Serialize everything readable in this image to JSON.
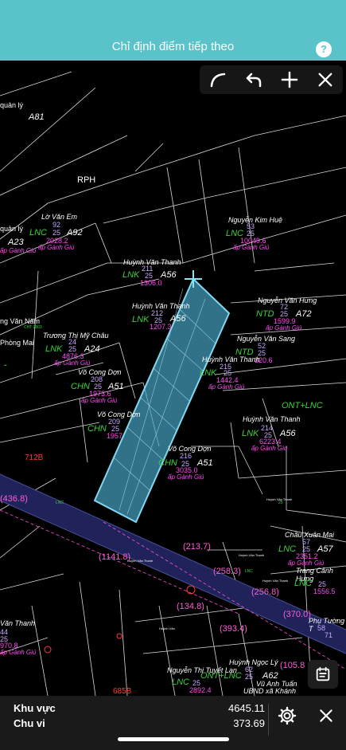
{
  "header": {
    "title": "Chỉ định điểm tiếp theo",
    "help_label": "?"
  },
  "toolbar": {
    "icons": [
      "curve-tool-icon",
      "undo-icon",
      "add-point-icon",
      "close-icon"
    ]
  },
  "colors": {
    "header_bg": "#5ac3c9",
    "map_bg": "#000000",
    "parcel_fill": "#5ab4d2",
    "land_code": "#3ad13a",
    "parcel_number": "#c8a6ff",
    "area": "#ff4df2",
    "road": "#2a2f6e",
    "dimension": "#ff5cd8"
  },
  "map": {
    "labels": {
      "quan_ly_top": "quản lý",
      "a81": "A81",
      "rph": "RPH",
      "lo_van_em": "Lờ Văn Em",
      "lnc_1": "LNC",
      "num_92": "92",
      "num_25a": "25",
      "a92": "A92",
      "area_2028": "2028.2",
      "ap_1": "ấp Gành Giú",
      "quan_ly_2": "quản lý",
      "a23": "A23",
      "ap_2": "ấp Gành Giú",
      "nguyen_kim_hue": "Nguyễn Kim Huệ",
      "num_53": "53",
      "lnc_2": "LNC",
      "num_25b": "25",
      "area_10049": "10049.6",
      "ap_3": "ấp Gành Giú",
      "huynh_van_thanh_1": "Huỳnh Văn Thanh",
      "lnk_1": "LNK",
      "num_211": "211",
      "num_25c": "25",
      "a56_1": "A56",
      "area_1306": "1306.0",
      "huynh_van_thanh_2": "Huỳnh Văn Thanh",
      "lnk_2": "LNK",
      "num_212": "212",
      "num_25d": "25",
      "a56_2": "A56",
      "area_1207": "1207.3",
      "nguyen_van_hung": "Nguyễn Văn Hưng",
      "ntd_1": "NTD",
      "num_72": "72",
      "num_25e": "25",
      "a72": "A72",
      "area_1599": "1599.9",
      "ap_4": "ấp Gành Giú",
      "ng_van_nam": "ng Văn Năm",
      "phong_mai": "Phòng Mai",
      "truong_thi_my_chau": "Trương Thị Mỹ Châu",
      "lnk_3": "LNK",
      "num_24": "24",
      "num_25f": "25",
      "a24": "A24",
      "area_4876": "4876.3",
      "ap_5": "ấp Gành Giú",
      "nguyen_van_sang": "Nguyễn Văn Sang",
      "ntd_2": "NTD",
      "num_52": "52",
      "num_25g": "25",
      "area_320": "320.6",
      "vo_cong_don_1": "Võ Cong Dợn",
      "chn_1": "CHN",
      "num_208": "208",
      "num_25h": "25",
      "a51_1": "A51",
      "area_1973": "1973.6",
      "ap_6": "ấp Gành Giú",
      "huynh_van_thanh_3": "Huỳnh Văn Thanh",
      "lnk_4": "LNK",
      "num_215": "215",
      "num_25i": "25",
      "area_1442": "1442.4",
      "ap_7": "ấp Gành Giú",
      "ont_lnc_1": "ONT+LNC",
      "vo_cong_don_2": "Võ Cong Dợn",
      "chn_2": "CHN",
      "num_209": "209",
      "num_25j": "25",
      "area_1957": "1957",
      "huynh_van_thanh_4": "Huỳnh Văn Thanh",
      "lnk_5": "LNK",
      "num_214": "214",
      "num_25k": "25",
      "a56_3": "A56",
      "area_6223": "6223.4",
      "ap_8": "ấp Gành Giú",
      "vo_cong_don_3": "Võ Cong Dợn",
      "chn_3": "CHN",
      "num_216": "216",
      "num_25l": "25",
      "a51_2": "A51",
      "area_3035": "3035.0",
      "ap_9": "ấp Gành Giú",
      "num_712b": "712B",
      "dim_436": "(436.8)",
      "dim_1141": "(1141.8)",
      "dim_213": "(213.7)",
      "dim_258_3": "(258.3)",
      "dim_256": "(256.8)",
      "dim_370": "(370.0)",
      "dim_134": "(134.8)",
      "dim_393": "(393.4)",
      "dim_105": "(105.8",
      "chau_xuan_mai": "Châu Xuân Mai",
      "lnc_3": "LNC",
      "num_57": "57",
      "num_25m": "25",
      "a57": "A57",
      "area_2351": "2351.2",
      "ap_10": "ấp Gành Giú",
      "trang_canh_hung": "Trang Cảnh Hưng",
      "lnc_4": "LNC",
      "num_25n": "25",
      "area_1556": "1556.5",
      "phu_tuong": "Phụ Tường T",
      "num_58": "58",
      "van_thanh_bl": "Văn Thanh",
      "num_44": "44",
      "num_25o": "25",
      "area_970": "970.8",
      "ap_11": "ấp Gành Giú",
      "huynh_ngoc_ly": "Huỳnh Ngọc Lý",
      "num_62": "62",
      "a62": "A62",
      "num_25p": "25",
      "nguyen_thi_tuyet_lan": "Nguyễn Thị Tuyết Lan",
      "lnc_5": "LNC",
      "ont_lnc_2": "ONT+LNC",
      "num_25q": "25",
      "area_2892": "2892.4",
      "vu_anh_tuan": "Vũ Anh Tuấn",
      "ubnd": "UBND xã Khánh",
      "num_685b": "685B",
      "num_71": "71",
      "num_2y": "2"
    }
  },
  "bottom": {
    "area_label": "Khu vực",
    "area_value": "4645.11",
    "perimeter_label": "Chu vi",
    "perimeter_value": "373.69"
  }
}
